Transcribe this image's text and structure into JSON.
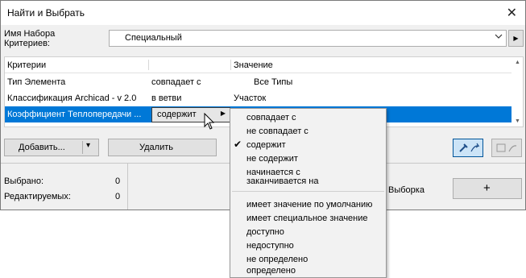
{
  "window": {
    "title": "Найти и Выбрать",
    "close_icon": "close-icon"
  },
  "criteria_set": {
    "label_line1": "Имя Набора",
    "label_line2": "Критериев:",
    "value": "Специальный"
  },
  "table": {
    "headers": {
      "criteria": "Критерии",
      "value": "Значение"
    },
    "rows": [
      {
        "criterion": "Тип Элемента",
        "operator": "совпадает с",
        "value": "Все Типы"
      },
      {
        "criterion": "Классификация Archicad - v 2.0",
        "operator": "в ветви",
        "value": "Участок"
      },
      {
        "criterion": "Коэффициент Теплопередачи ...",
        "operator": "содержит",
        "value": ""
      }
    ]
  },
  "buttons": {
    "add": "Добавить...",
    "remove": "Удалить",
    "selection": "Выборка",
    "plus": "+"
  },
  "stats": {
    "selected_label": "Выбрано:",
    "selected_value": "0",
    "editable_label": "Редактируемых:",
    "editable_value": "0"
  },
  "menu": {
    "group1": [
      "совпадает с",
      "не совпадает с",
      "содержит",
      "не содержит",
      "начинается с",
      "заканчивается на"
    ],
    "group2": [
      "имеет значение по умолчанию",
      "имеет специальное значение",
      "доступно",
      "недоступно",
      "не определено",
      "определено"
    ],
    "checked": "содержит"
  },
  "colors": {
    "selection": "#0078d7",
    "window_bg": "#f0f0f0"
  }
}
